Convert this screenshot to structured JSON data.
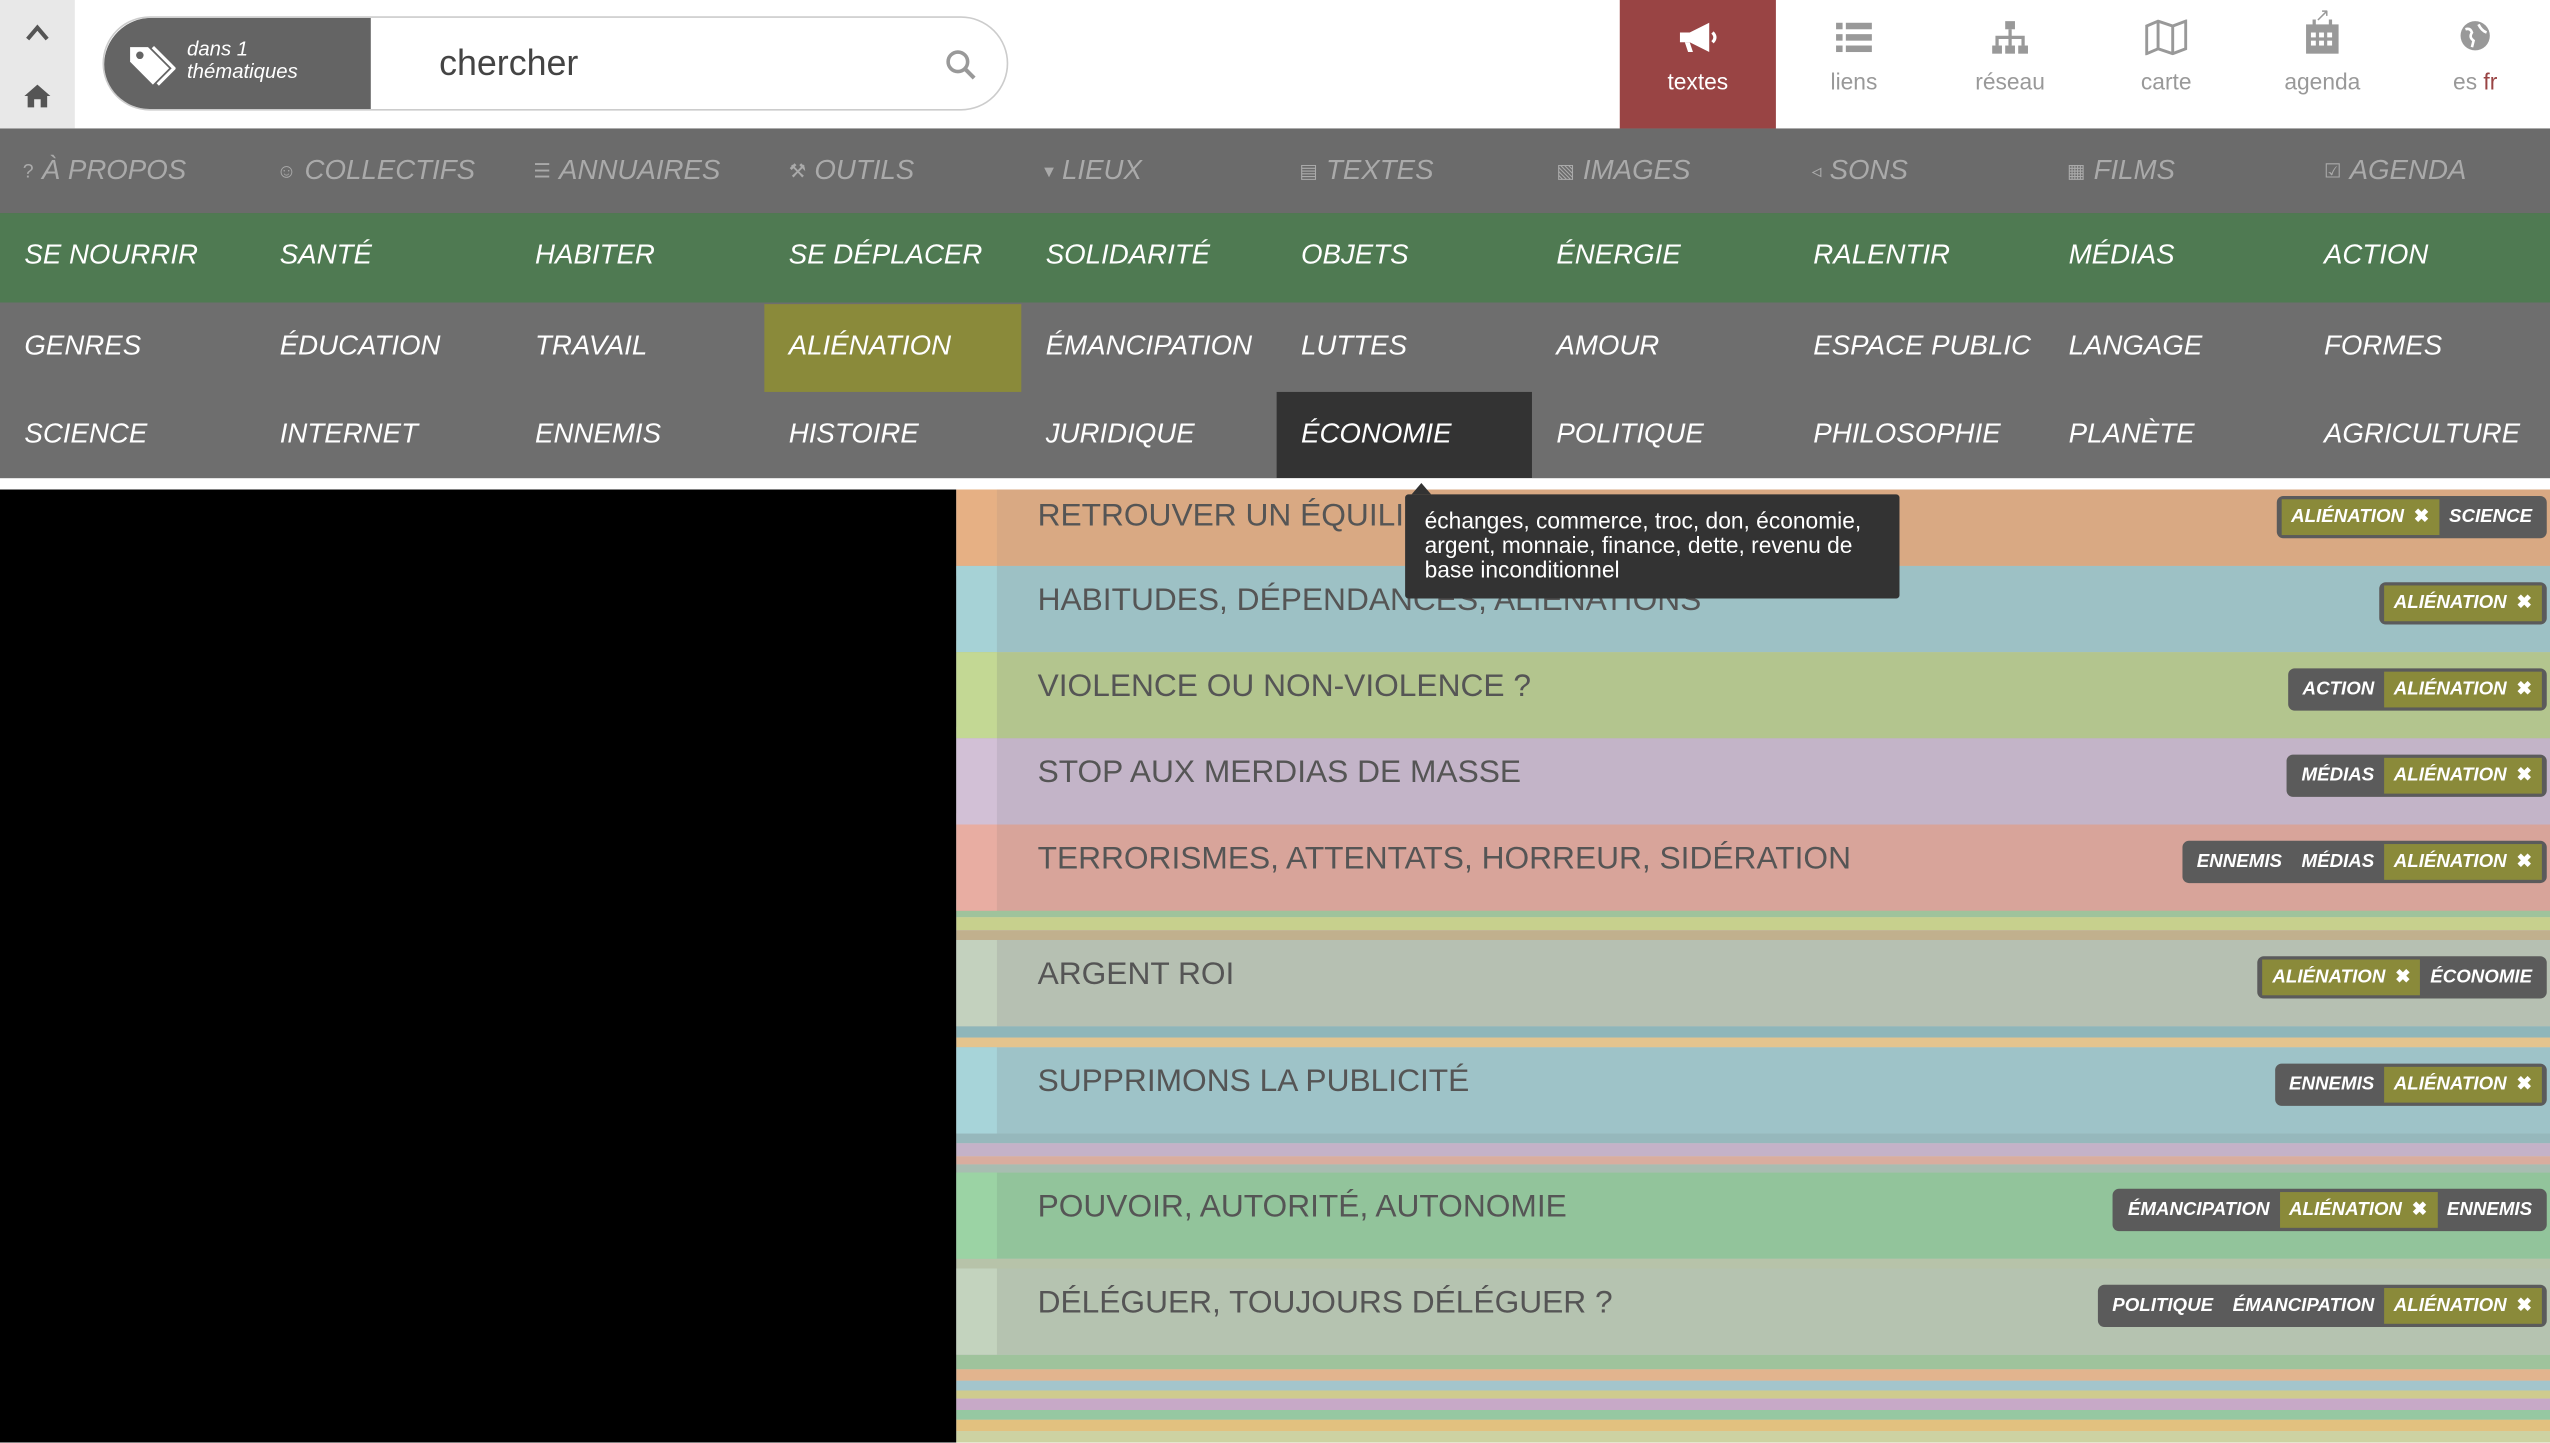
{
  "search": {
    "scope_line1": "dans 1",
    "scope_line2": "thématiques",
    "placeholder": "chercher"
  },
  "nav_tabs": [
    {
      "label": "textes",
      "icon": "megaphone-icon",
      "active": true
    },
    {
      "label": "liens",
      "icon": "list-icon"
    },
    {
      "label": "réseau",
      "icon": "network-icon"
    },
    {
      "label": "carte",
      "icon": "map-icon"
    },
    {
      "label": "agenda",
      "icon": "calendar-icon"
    }
  ],
  "languages": {
    "es": "es",
    "fr": "fr"
  },
  "menu": [
    {
      "label": "À PROPOS",
      "icon": "question-icon"
    },
    {
      "label": "COLLECTIFS",
      "icon": "users-icon"
    },
    {
      "label": "ANNUAIRES",
      "icon": "database-icon"
    },
    {
      "label": "OUTILS",
      "icon": "wrench-icon"
    },
    {
      "label": "LIEUX",
      "icon": "pin-icon"
    },
    {
      "label": "TEXTES",
      "icon": "file-icon"
    },
    {
      "label": "IMAGES",
      "icon": "image-icon"
    },
    {
      "label": "SONS",
      "icon": "volume-icon"
    },
    {
      "label": "FILMS",
      "icon": "film-icon"
    },
    {
      "label": "AGENDA",
      "icon": "calendar-check-icon"
    }
  ],
  "themes": [
    [
      "SE NOURRIR",
      "SANTÉ",
      "HABITER",
      "SE DÉPLACER",
      "SOLIDARITÉ",
      "OBJETS",
      "ÉNERGIE",
      "RALENTIR",
      "MÉDIAS",
      "ACTION"
    ],
    [
      "GENRES",
      "ÉDUCATION",
      "TRAVAIL",
      "ALIÉNATION",
      "ÉMANCIPATION",
      "LUTTES",
      "AMOUR",
      "ESPACE PUBLIC",
      "LANGAGE",
      "FORMES"
    ],
    [
      "SCIENCE",
      "INTERNET",
      "ENNEMIS",
      "HISTOIRE",
      "JURIDIQUE",
      "ÉCONOMIE",
      "POLITIQUE",
      "PHILOSOPHIE",
      "PLANÈTE",
      "AGRICULTURE"
    ]
  ],
  "selected_theme": "ALIÉNATION",
  "hovered_theme": "ÉCONOMIE",
  "tooltip": "échanges, commerce, troc, don, économie, argent, monnaie, finance, dette, revenu de base inconditionnel",
  "articles": [
    {
      "title": "RETROUVER UN ÉQUILIBRE",
      "color": "#d9a983",
      "accent": "#e6b084",
      "tags": [
        {
          "t": "ALIÉNATION",
          "sel": true
        },
        {
          "t": "SCIENCE"
        }
      ]
    },
    {
      "title": "HABITUDES, DÉPENDANCES, ALIÉNATIONS",
      "color": "#9dc1c5",
      "accent": "#a6d2d6",
      "tags": [
        {
          "t": "ALIÉNATION",
          "sel": true
        }
      ]
    },
    {
      "title": "VIOLENCE OU NON-VIOLENCE ?",
      "color": "#b3c58e",
      "accent": "#c3d894",
      "tags": [
        {
          "t": "ACTION"
        },
        {
          "t": "ALIÉNATION",
          "sel": true
        }
      ]
    },
    {
      "title": "STOP AUX MERDIAS DE MASSE",
      "color": "#c3b4c8",
      "accent": "#d2c0d6",
      "tags": [
        {
          "t": "MÉDIAS"
        },
        {
          "t": "ALIÉNATION",
          "sel": true
        }
      ]
    },
    {
      "title": "TERRORISMES, ATTENTATS, HORREUR, SIDÉRATION",
      "color": "#d8a49a",
      "accent": "#e8ada2",
      "tags": [
        {
          "t": "ENNEMIS"
        },
        {
          "t": "MÉDIAS"
        },
        {
          "t": "ALIÉNATION",
          "sel": true
        }
      ]
    },
    {
      "title": "ARGENT ROI",
      "color": "#b6c0b2",
      "accent": "#c3d1be",
      "tags": [
        {
          "t": "ALIÉNATION",
          "sel": true
        },
        {
          "t": "ÉCONOMIE"
        }
      ]
    },
    {
      "title": "SUPPRIMONS LA PUBLICITÉ",
      "color": "#9ec3c8",
      "accent": "#a7d4d9",
      "tags": [
        {
          "t": "ENNEMIS"
        },
        {
          "t": "ALIÉNATION",
          "sel": true
        }
      ]
    },
    {
      "title": "POUVOIR, AUTORITÉ, AUTONOMIE",
      "color": "#92c49b",
      "accent": "#9bd3a4",
      "tags": [
        {
          "t": "ÉMANCIPATION"
        },
        {
          "t": "ALIÉNATION",
          "sel": true
        },
        {
          "t": "ENNEMIS"
        }
      ]
    },
    {
      "title": "DÉLÉGUER, TOUJOURS DÉLÉGUER ?",
      "color": "#b5c3b0",
      "accent": "#c3d3be",
      "tags": [
        {
          "t": "POLITIQUE"
        },
        {
          "t": "ÉMANCIPATION"
        },
        {
          "t": "ALIÉNATION",
          "sel": true
        }
      ]
    }
  ],
  "colors": {
    "active_tab": "#994444",
    "selected_theme": "#8a8a3a",
    "hovered_theme": "#333333",
    "theme_green_row": "#4f7a52"
  }
}
